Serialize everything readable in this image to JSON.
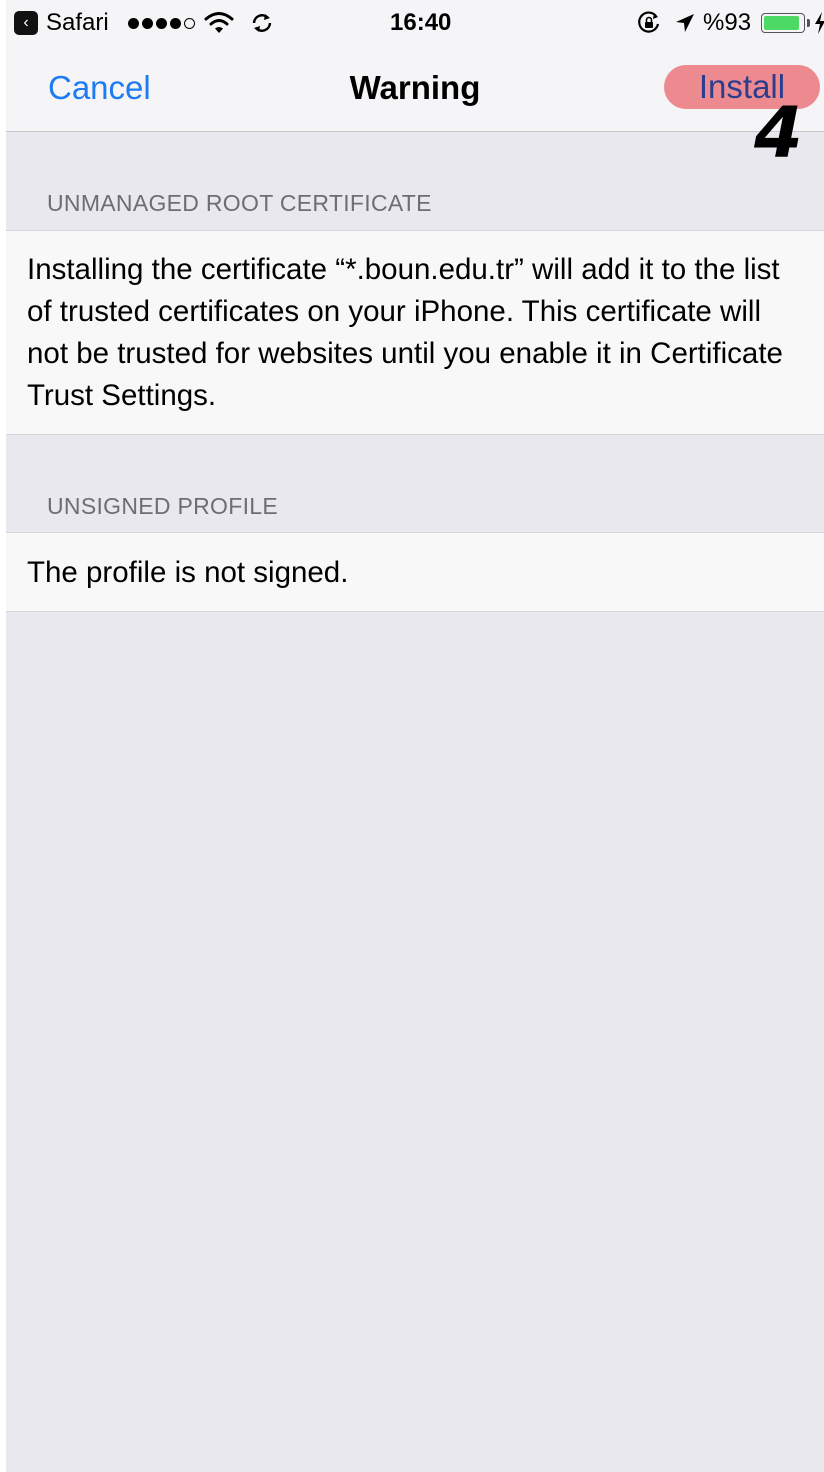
{
  "status_bar": {
    "back_app": "Safari",
    "time": "16:40",
    "battery_percent": "%93",
    "battery_level": 0.93,
    "signal_bars_filled": 4,
    "signal_bars_total": 5,
    "icons": [
      "back-arrow-icon",
      "wifi-icon",
      "sync-icon",
      "rotation-lock-icon",
      "location-arrow-icon",
      "battery-icon",
      "charging-bolt-icon"
    ]
  },
  "nav": {
    "cancel_label": "Cancel",
    "title": "Warning",
    "install_label": "Install",
    "step_annotation": "4",
    "highlight_color": "#ec8a8f",
    "accent_color": "#1e7cf2"
  },
  "sections": [
    {
      "header": "UNMANAGED ROOT CERTIFICATE",
      "body": "Installing the certificate “*.boun.edu.tr” will add it to the list of trusted certificates on your iPhone. This certificate will not be trusted for websites until you enable it in Certificate Trust Settings."
    },
    {
      "header": "UNSIGNED PROFILE",
      "body": "The profile is not signed."
    }
  ]
}
